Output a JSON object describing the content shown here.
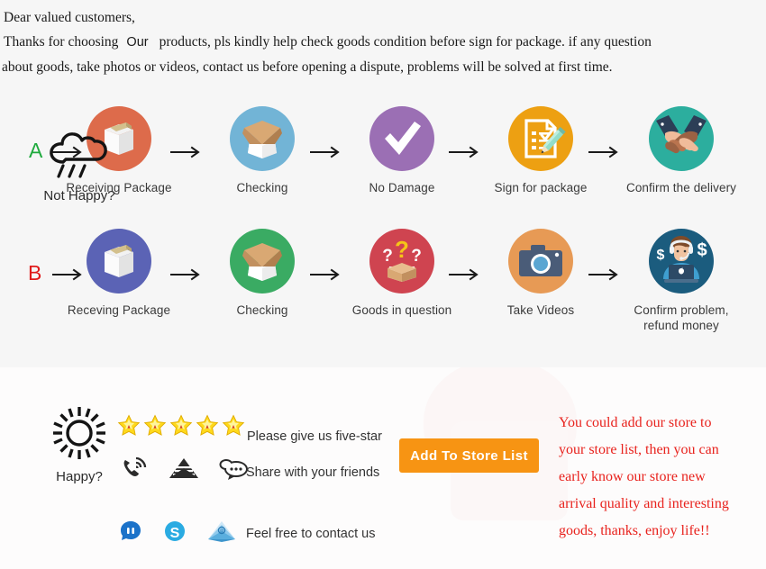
{
  "header": {
    "line1": "Dear valued customers,",
    "line2_before": "Thanks for choosing",
    "line2_our": "Our",
    "line2_after": "products, pls kindly help check goods condition before sign for package. if any question",
    "line3": "about goods, take photos or videos, contact us before opening a dispute, problems will be solved at first time."
  },
  "flow": {
    "row_a": {
      "label": "A",
      "label_color": "#1faa3d",
      "steps": [
        {
          "label": "Receiving Package",
          "icon": "sealed-box-icon",
          "color": "#dd6b4b"
        },
        {
          "label": "Checking",
          "icon": "open-box-icon",
          "color": "#72b4d6"
        },
        {
          "label": "No Damage",
          "icon": "checkmark-icon",
          "color": "#9b6fb4"
        },
        {
          "label": "Sign for package",
          "icon": "sign-document-icon",
          "color": "#eda012"
        },
        {
          "label": "Confirm the delivery",
          "icon": "handshake-icon",
          "color": "#2cae9e"
        }
      ]
    },
    "row_b": {
      "label": "B",
      "label_color": "#e01b1b",
      "steps": [
        {
          "label": "Receving Package",
          "icon": "sealed-box-icon",
          "color": "#5b63b5"
        },
        {
          "label": "Checking",
          "icon": "open-box-icon",
          "color": "#3aab63"
        },
        {
          "label": "Goods in question",
          "icon": "question-box-icon",
          "color": "#cf4450"
        },
        {
          "label": "Take Videos",
          "icon": "camera-icon",
          "color": "#e79a55"
        },
        {
          "label": "Confirm problem,\nrefund money",
          "icon": "support-agent-icon",
          "color": "#1b5c7e"
        }
      ]
    }
  },
  "bottom": {
    "happy_label": "Happy?",
    "not_happy_label": "Not Happy?",
    "happy_icon": "sun-icon",
    "not_happy_icon": "rain-cloud-icon",
    "star_count": 5,
    "star_color": "#ffd91c",
    "messages": {
      "five_star": "Please give us five-star",
      "share": "Share with your friends",
      "contact": "Feel free to contact us"
    },
    "contact_icons_row1": [
      "phone-ring-icon",
      "email-envelope-icon",
      "chat-bubble-icon"
    ],
    "contact_icons_row2": [
      "aliwangwang-icon",
      "skype-icon",
      "mail-envelope-blue-icon"
    ],
    "store_button_label": "Add To Store List",
    "store_button_color": "#f79413",
    "promo_color": "#e8221d",
    "promo_lines": [
      "You could add our store to",
      "your store list, then you can",
      "early know our store new",
      "arrival quality and interesting",
      "goods, thanks, enjoy life!!"
    ]
  }
}
